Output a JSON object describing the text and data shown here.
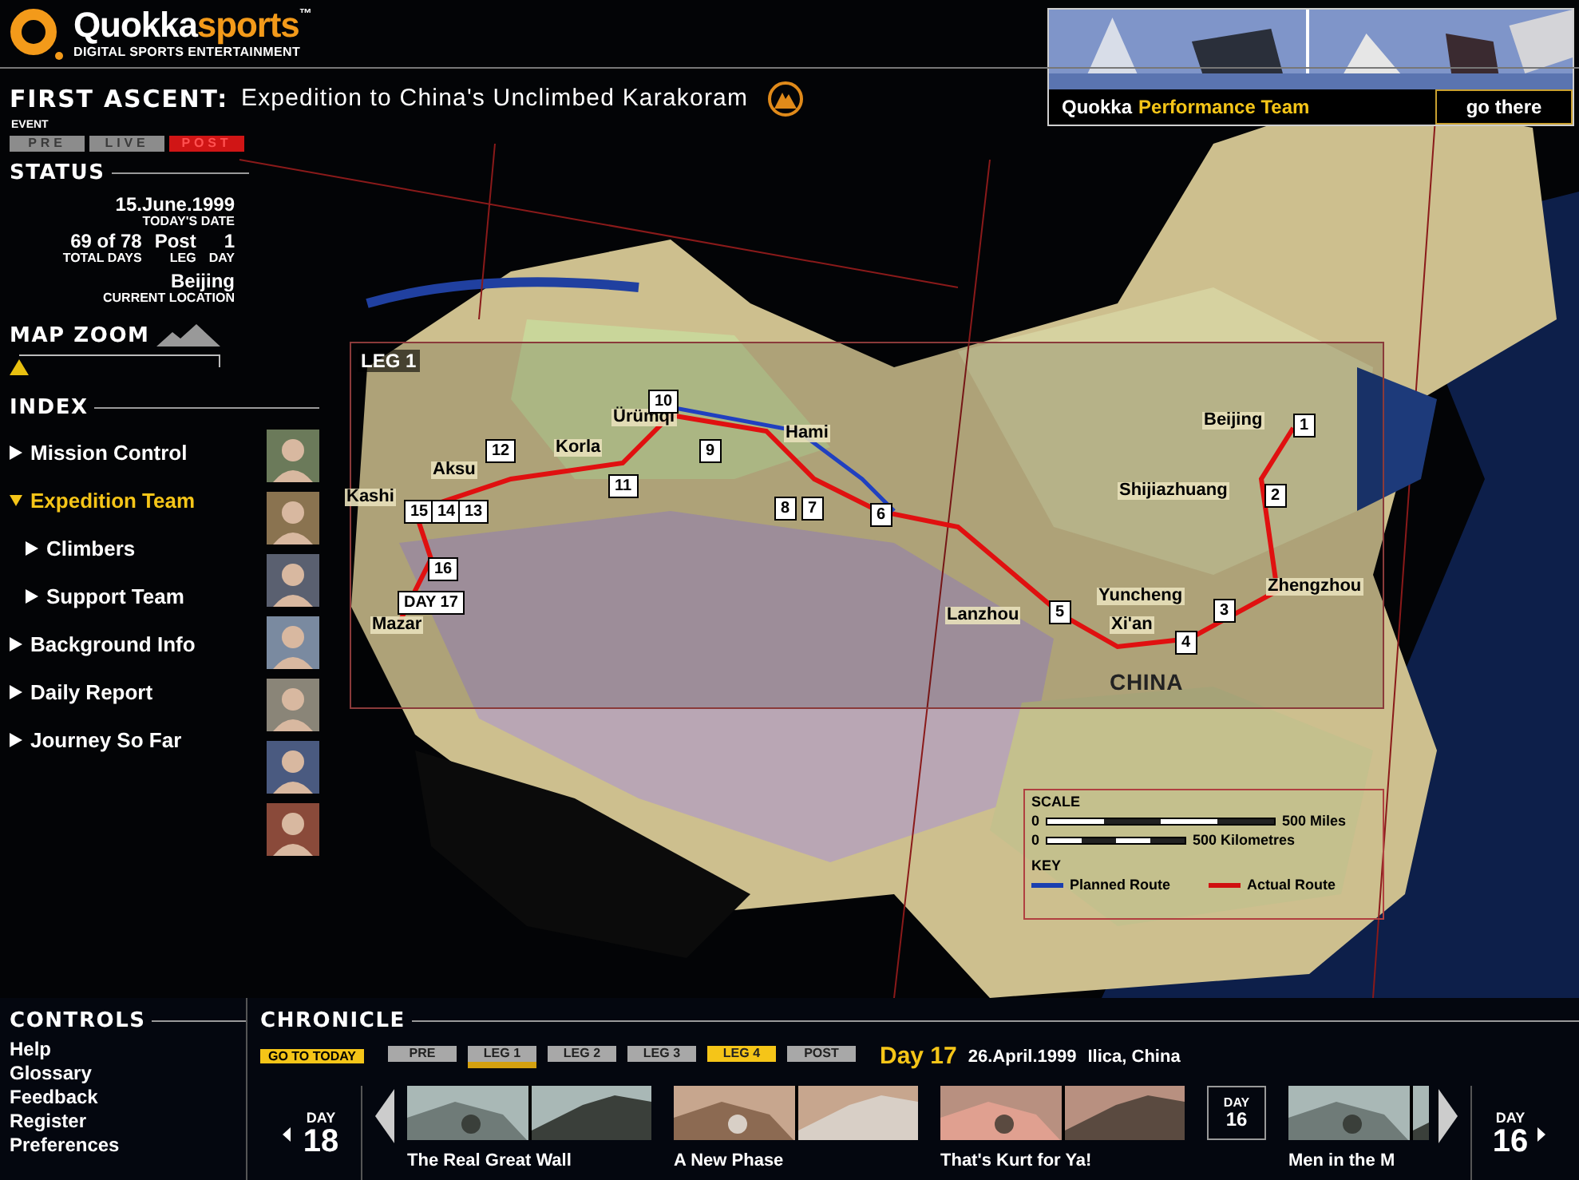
{
  "logo": {
    "parts": [
      "Quokka",
      "sports",
      "™"
    ],
    "tagline": "DIGITAL SPORTS ENTERTAINMENT"
  },
  "event": {
    "label": "FIRST ASCENT:",
    "title": "Expedition to China's Unclimbed Karakoram",
    "caption": "EVENT"
  },
  "promo": {
    "brand": "Quokka",
    "title": "Performance Team",
    "button": "go there"
  },
  "phases": [
    {
      "label": "PRE",
      "selected": false
    },
    {
      "label": "LIVE",
      "selected": false
    },
    {
      "label": "POST",
      "selected": true
    }
  ],
  "status": {
    "heading": "STATUS",
    "date": "15.June.1999",
    "date_label": "TODAY'S DATE",
    "total_days": "69 of 78",
    "total_days_label": "TOTAL DAYS",
    "leg": "Post",
    "leg_label": "LEG",
    "day": "1",
    "day_label": "DAY",
    "location": "Beijing",
    "location_label": "CURRENT LOCATION"
  },
  "map_zoom": {
    "heading": "MAP ZOOM",
    "level": 0
  },
  "index": {
    "heading": "INDEX",
    "items": [
      {
        "label": "Mission Control",
        "selected": false,
        "expanded": false
      },
      {
        "label": "Expedition Team",
        "selected": true,
        "expanded": true,
        "children": [
          {
            "label": "Climbers",
            "selected": false,
            "expanded": false
          },
          {
            "label": "Support Team",
            "selected": false,
            "expanded": false
          }
        ]
      },
      {
        "label": "Background Info",
        "selected": false,
        "expanded": false
      },
      {
        "label": "Daily Report",
        "selected": false,
        "expanded": false
      },
      {
        "label": "Journey So Far",
        "selected": false,
        "expanded": false
      }
    ]
  },
  "map": {
    "leg_label": "LEG 1",
    "country": "CHINA",
    "cities": [
      "Beijing",
      "Shijiazhuang",
      "Yuncheng",
      "Xi'an",
      "Zhengzhou",
      "Lanzhou",
      "Hami",
      "Ürümqi",
      "Korla",
      "Aksu",
      "Kashi",
      "Mazar"
    ],
    "markers": [
      "1",
      "2",
      "3",
      "4",
      "5",
      "6",
      "8",
      "7",
      "9",
      "10",
      "11",
      "12",
      "15",
      "14",
      "13",
      "16",
      "DAY 17"
    ],
    "scale": {
      "heading": "SCALE",
      "zero_1": "0",
      "miles": "500 Miles",
      "zero_2": "0",
      "kilometres": "500 Kilometres"
    },
    "key": {
      "heading": "KEY",
      "planned": "Planned Route",
      "actual": "Actual Route"
    }
  },
  "controls": {
    "heading": "CONTROLS",
    "items": [
      "Help",
      "Glossary",
      "Feedback",
      "Register",
      "Preferences"
    ]
  },
  "chronicle": {
    "heading": "CHRONICLE",
    "today_button": "GO TO TODAY",
    "legs": [
      {
        "label": "PRE",
        "selected": false,
        "current": false
      },
      {
        "label": "LEG 1",
        "selected": true,
        "current": false
      },
      {
        "label": "LEG 2",
        "selected": false,
        "current": false
      },
      {
        "label": "LEG 3",
        "selected": false,
        "current": false
      },
      {
        "label": "LEG 4",
        "selected": false,
        "current": true
      },
      {
        "label": "POST",
        "selected": false,
        "current": false
      }
    ],
    "day_title": "Day 17",
    "date": "26.April.1999",
    "place": "Ilica, China",
    "prev": {
      "label": "DAY",
      "number": "18"
    },
    "next": {
      "label": "DAY",
      "number": "16"
    },
    "items": [
      {
        "kind": "story",
        "title": "The Real Great Wall"
      },
      {
        "kind": "story",
        "title": "A New Phase"
      },
      {
        "kind": "story",
        "title": "That's Kurt for Ya!"
      },
      {
        "kind": "day",
        "label": "DAY",
        "number": "16"
      },
      {
        "kind": "story",
        "title": "Men in the M"
      }
    ]
  }
}
